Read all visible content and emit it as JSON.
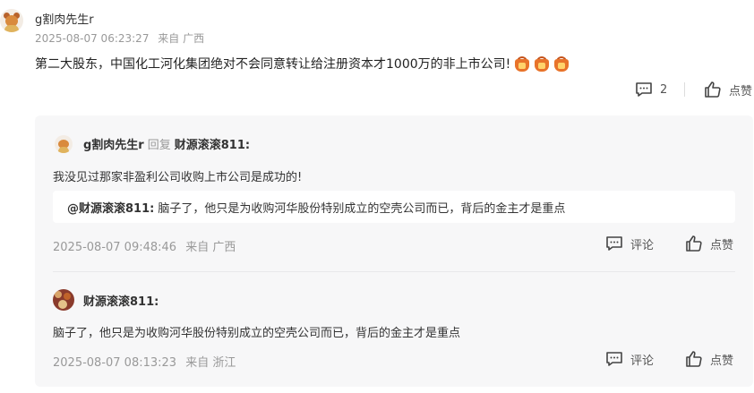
{
  "main_comment": {
    "username": "g割肉先生r",
    "time": "2025-08-07 06:23:27",
    "location": "来自 广西",
    "text": "第二大股东，中国化工河化集团绝对不会同意转让给注册资本才1000万的非上市公司!",
    "emojis": [
      "money-bag-icon",
      "money-bag-icon",
      "money-bag-icon"
    ],
    "comment_count": "2",
    "like_label": "点赞"
  },
  "replies": [
    {
      "username": "g割肉先生r",
      "reply_word": "回复",
      "target": "财源滚滚811:",
      "text": "我没见过那家非盈利公司收购上市公司是成功的!",
      "quote_name": "@财源滚滚811:",
      "quote_text": "脑子了，他只是为收购河华股份特别成立的空壳公司而已，背后的金主才是重点",
      "time": "2025-08-07 09:48:46",
      "location": "来自 广西",
      "comment_label": "评论",
      "like_label": "点赞"
    },
    {
      "username": "财源滚滚811:",
      "text": "脑子了，他只是为收购河华股份特别成立的空壳公司而已，背后的金主才是重点",
      "time": "2025-08-07 08:13:23",
      "location": "来自 浙江",
      "comment_label": "评论",
      "like_label": "点赞"
    }
  ],
  "colors": {
    "text": "#333333",
    "muted": "#999999",
    "reply_bg": "#f7f7f8",
    "emoji_orange": "#e8732a"
  }
}
